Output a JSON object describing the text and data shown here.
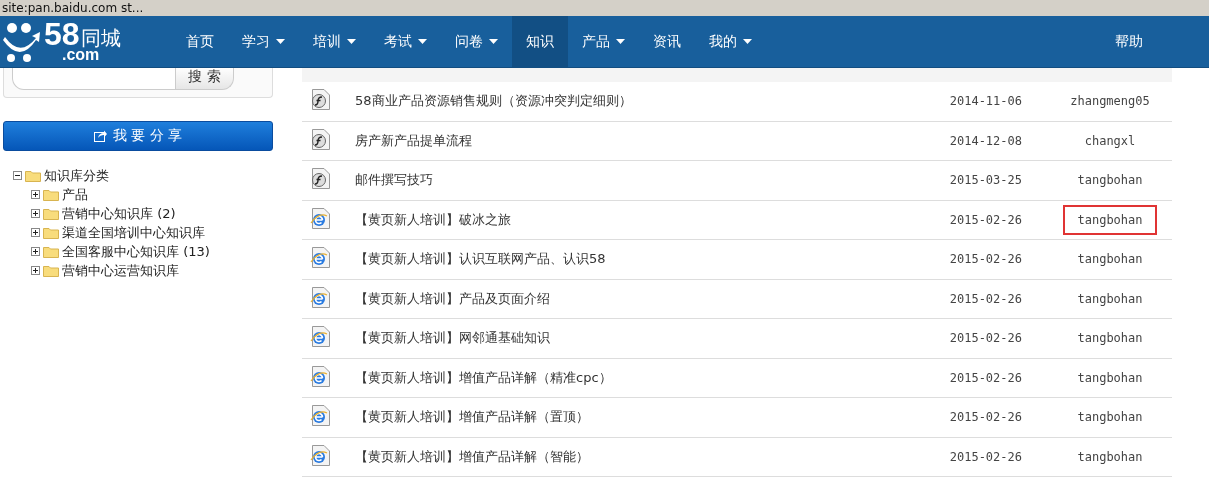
{
  "address_bar": {
    "text": "site:pan.baidu.com st..."
  },
  "logo": {
    "number": "58",
    "name": "同城",
    "domain": ".com"
  },
  "nav": [
    {
      "label": "首页",
      "dropdown": false,
      "selected": false
    },
    {
      "label": "学习",
      "dropdown": true,
      "selected": false
    },
    {
      "label": "培训",
      "dropdown": true,
      "selected": false
    },
    {
      "label": "考试",
      "dropdown": true,
      "selected": false
    },
    {
      "label": "问卷",
      "dropdown": true,
      "selected": false
    },
    {
      "label": "知识",
      "dropdown": false,
      "selected": true
    },
    {
      "label": "产品",
      "dropdown": true,
      "selected": false
    },
    {
      "label": "资讯",
      "dropdown": false,
      "selected": false
    },
    {
      "label": "我的",
      "dropdown": true,
      "selected": false
    }
  ],
  "nav_right": {
    "label": "帮助"
  },
  "sidebar": {
    "search_button": "搜 索",
    "share_button": "我 要 分 享",
    "tree": {
      "label": "知识库分类",
      "expanded": true,
      "children": [
        {
          "label": "产品",
          "expanded": false
        },
        {
          "label": "营销中心知识库 (2)",
          "expanded": false
        },
        {
          "label": "渠道全国培训中心知识库",
          "expanded": false
        },
        {
          "label": "全国客服中心知识库 (13)",
          "expanded": false
        },
        {
          "label": "营销中心运营知识库",
          "expanded": false
        }
      ]
    }
  },
  "table": {
    "rows": [
      {
        "kind": "flash",
        "name": "58商业产品资源销售规则（资源冲突判定细则）",
        "date": "2014-11-06",
        "publisher": "zhangmeng05",
        "highlighted": false
      },
      {
        "kind": "flash",
        "name": "房产新产品提单流程",
        "date": "2014-12-08",
        "publisher": "changxl",
        "highlighted": false
      },
      {
        "kind": "flash",
        "name": "邮件撰写技巧",
        "date": "2015-03-25",
        "publisher": "tangbohan",
        "highlighted": false
      },
      {
        "kind": "web",
        "name": "【黄页新人培训】破冰之旅",
        "date": "2015-02-26",
        "publisher": "tangbohan",
        "highlighted": true
      },
      {
        "kind": "web",
        "name": "【黄页新人培训】认识互联网产品、认识58",
        "date": "2015-02-26",
        "publisher": "tangbohan",
        "highlighted": false
      },
      {
        "kind": "web",
        "name": "【黄页新人培训】产品及页面介绍",
        "date": "2015-02-26",
        "publisher": "tangbohan",
        "highlighted": false
      },
      {
        "kind": "web",
        "name": "【黄页新人培训】网邻通基础知识",
        "date": "2015-02-26",
        "publisher": "tangbohan",
        "highlighted": false
      },
      {
        "kind": "web",
        "name": "【黄页新人培训】增值产品详解（精准cpc）",
        "date": "2015-02-26",
        "publisher": "tangbohan",
        "highlighted": false
      },
      {
        "kind": "web",
        "name": "【黄页新人培训】增值产品详解（置顶）",
        "date": "2015-02-26",
        "publisher": "tangbohan",
        "highlighted": false
      },
      {
        "kind": "web",
        "name": "【黄页新人培训】增值产品详解（智能）",
        "date": "2015-02-26",
        "publisher": "tangbohan",
        "highlighted": false
      }
    ]
  }
}
